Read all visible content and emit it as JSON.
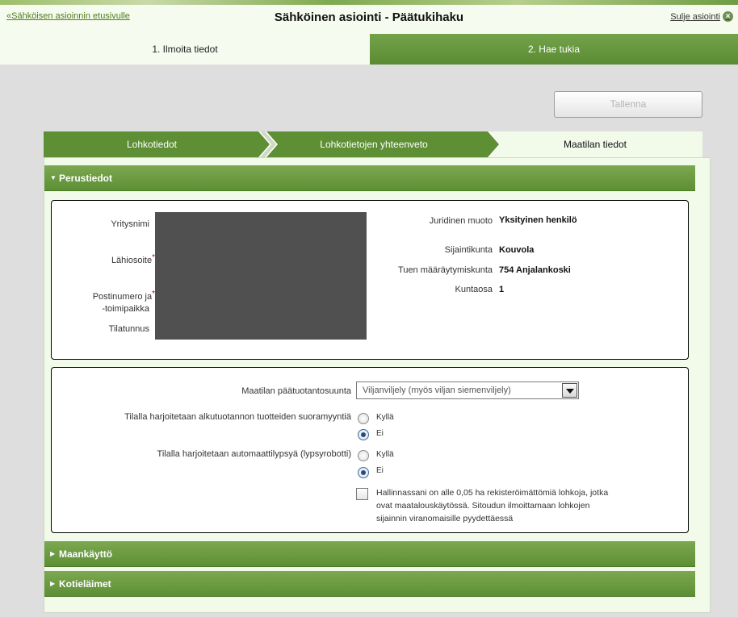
{
  "header": {
    "home_link": "«Sähköisen asioinnin etusivulle",
    "title": "Sähköinen asiointi  -  Päätukihaku",
    "close_link": "Sulje asiointi",
    "close_icon": "close-icon"
  },
  "main_tabs": [
    {
      "label": "1. Ilmoita tiedot",
      "active": true
    },
    {
      "label": "2. Hae tukia",
      "active": false
    }
  ],
  "toolbar": {
    "save_label": "Tallenna",
    "save_enabled": false
  },
  "steps": [
    {
      "label": "Lohkotiedot",
      "active": false
    },
    {
      "label": "Lohkotietojen yhteenveto",
      "active": false
    },
    {
      "label": "Maatilan tiedot",
      "active": true
    }
  ],
  "sections": {
    "basic": {
      "title": "Perustiedot",
      "expanded": true,
      "left_labels": {
        "company": "Yritysnimi",
        "address": "Lähiosoite",
        "postal_1": "Postinumero ja",
        "postal_2": "-toimipaikka",
        "farm_id": "Tilatunnus",
        "required_mark": "*"
      },
      "right_fields": {
        "legal_form_label": "Juridinen muoto",
        "legal_form_value": "Yksityinen henkilö",
        "municipality_label": "Sijaintikunta",
        "municipality_value": "Kouvola",
        "support_muni_label": "Tuen määräytymiskunta",
        "support_muni_value": "754 Anjalankoski",
        "muni_part_label": "Kuntaosa",
        "muni_part_value": "1"
      }
    },
    "production": {
      "main_line_label": "Maatilan päätuotantosuunta",
      "main_line_value": "Viljanviljely (myös viljan siemenviljely)",
      "direct_sales_label": "Tilalla harjoitetaan alkutuotannon tuotteiden suoramyyntiä",
      "robot_label": "Tilalla harjoitetaan automaattilypsyä (lypsyrobotti)",
      "option_yes": "Kyllä",
      "option_no": "Ei",
      "direct_sales_selected": "Ei",
      "robot_selected": "Ei",
      "checkbox_text": "Hallinnassani on alle 0,05 ha rekisteröimättömiä lohkoja, jotka ovat maatalouskäytössä. Sitoudun ilmoittamaan lohkojen sijainnin viranomaisille pyydettäessä",
      "checkbox_checked": false
    },
    "land_use": {
      "title": "Maankäyttö",
      "expanded": false
    },
    "livestock": {
      "title": "Kotieläimet",
      "expanded": false
    }
  },
  "colors": {
    "green_dark": "#5e8f35",
    "green_light_bg": "#f2fbea",
    "link_green": "#4e7d1e",
    "required_red": "#cc0000"
  }
}
